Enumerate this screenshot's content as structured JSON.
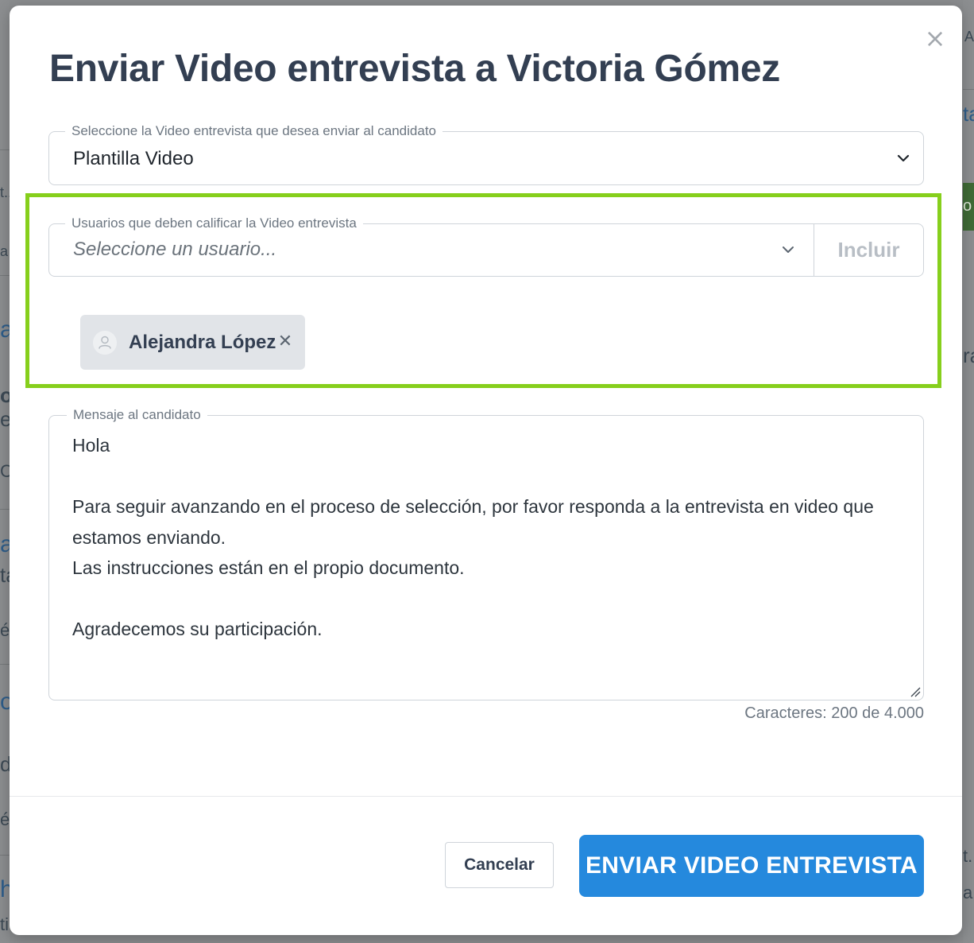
{
  "background": {
    "fragments": [
      "A",
      "a",
      "ra",
      "o",
      "o.",
      "e",
      "a",
      "ta",
      "é",
      "o",
      "d",
      "é",
      "h",
      "ti",
      "a",
      "a",
      "C",
      "t..",
      "a"
    ]
  },
  "modal": {
    "title": "Enviar Video entrevista a Victoria Gómez",
    "close_icon": "close-icon",
    "template_select": {
      "label": "Seleccione la Video entrevista que desea enviar al candidato",
      "value": "Plantilla Video"
    },
    "evaluators": {
      "label": "Usuarios que deben calificar la Video entrevista",
      "placeholder": "Seleccione un usuario...",
      "include_label": "Incluir",
      "chips": [
        {
          "name": "Alejandra López"
        }
      ]
    },
    "message": {
      "label": "Mensaje al candidato",
      "lines": [
        "Hola",
        "",
        "Para seguir avanzando en el proceso de selección, por favor responda a la entrevista en video que estamos enviando.",
        "Las instrucciones están en el propio documento.",
        "",
        "Agradecemos su participación."
      ]
    },
    "char_counter": "Caracteres: 200 de 4.000",
    "cancel_label": "Cancelar",
    "send_label": "ENVIAR VIDEO ENTREVISTA"
  },
  "colors": {
    "highlight": "#86cf1c",
    "primary": "#2589dd",
    "title": "#333f52"
  }
}
